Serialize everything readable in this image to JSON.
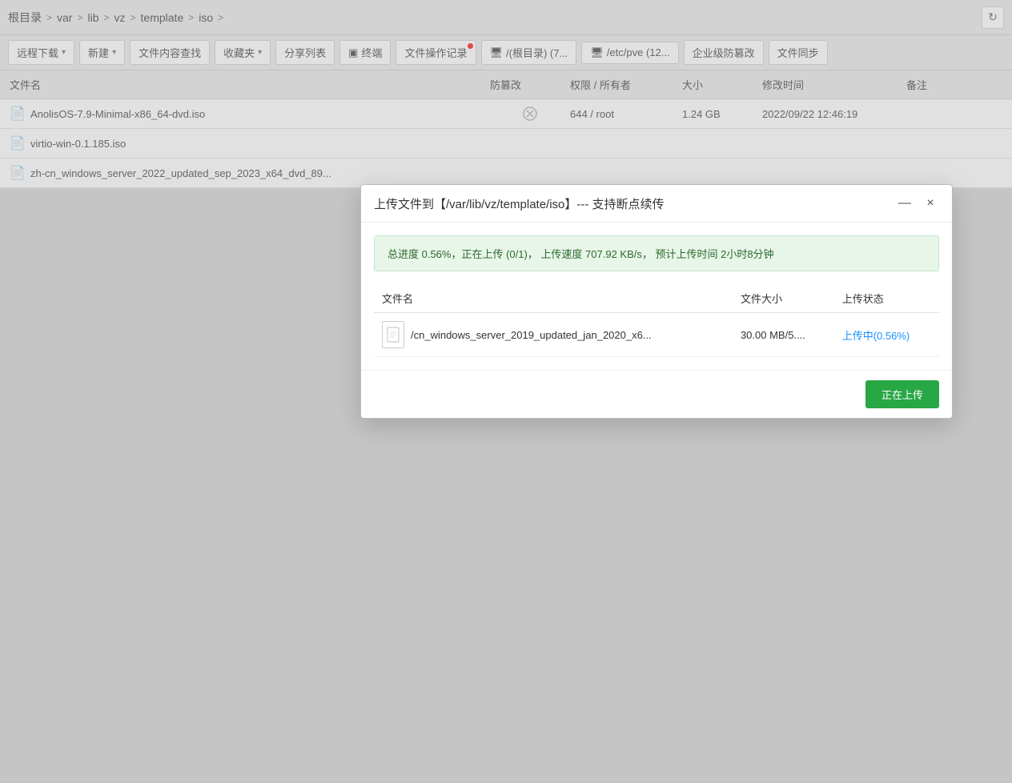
{
  "breadcrumb": {
    "items": [
      "根目录",
      "var",
      "lib",
      "vz",
      "template",
      "iso"
    ],
    "separators": [
      ">",
      ">",
      ">",
      ">",
      ">",
      ">"
    ]
  },
  "toolbar": {
    "buttons": [
      {
        "label": "远程下载",
        "dropdown": true,
        "id": "remote-download"
      },
      {
        "label": "新建",
        "dropdown": true,
        "id": "new"
      },
      {
        "label": "文件内容查找",
        "dropdown": false,
        "id": "find-content"
      },
      {
        "label": "收藏夹",
        "dropdown": true,
        "id": "favorites"
      },
      {
        "label": "分享列表",
        "dropdown": false,
        "id": "share-list"
      },
      {
        "label": "终端",
        "dropdown": false,
        "icon": "terminal",
        "id": "terminal"
      },
      {
        "label": "文件操作记录",
        "dropdown": false,
        "dot": true,
        "id": "file-ops"
      },
      {
        "label": "/(根目录) (7...",
        "dropdown": false,
        "icon": "disk",
        "id": "root-disk"
      },
      {
        "label": "/etc/pve (12...",
        "dropdown": false,
        "icon": "disk",
        "id": "pve-disk"
      },
      {
        "label": "企业级防篡改",
        "dropdown": false,
        "id": "enterprise-protect"
      },
      {
        "label": "文件同步",
        "dropdown": false,
        "id": "file-sync"
      }
    ]
  },
  "file_list": {
    "headers": [
      "文件名",
      "防篡改",
      "权限 / 所有者",
      "大小",
      "修改时间",
      "备注"
    ],
    "rows": [
      {
        "name": "AnolisOS-7.9-Minimal-x86_64-dvd.iso",
        "antivirus": "×",
        "permission": "644 / root",
        "size": "1.24 GB",
        "modified": "2022/09/22 12:46:19",
        "note": ""
      },
      {
        "name": "virtio-win-0.1.185.iso",
        "antivirus": "",
        "permission": "",
        "size": "",
        "modified": "",
        "note": ""
      },
      {
        "name": "zh-cn_windows_server_2022_updated_sep_2023_x64_dvd_89...",
        "antivirus": "",
        "permission": "",
        "size": "",
        "modified": "",
        "note": ""
      }
    ]
  },
  "dialog": {
    "title": "上传文件到【/var/lib/vz/template/iso】--- 支持断点续传",
    "minimize_label": "—",
    "close_label": "×",
    "progress_banner": "总进度 0.56%，正在上传 (0/1)，   上传速度 707.92 KB/s，    预计上传时间 2小时8分钟",
    "upload_table": {
      "headers": [
        "文件名",
        "文件大小",
        "上传状态"
      ],
      "rows": [
        {
          "filename": "/cn_windows_server_2019_updated_jan_2020_x6...",
          "size": "30.00 MB/5....",
          "status": "上传中(0.56%)"
        }
      ]
    },
    "footer_button": "正在上传"
  }
}
